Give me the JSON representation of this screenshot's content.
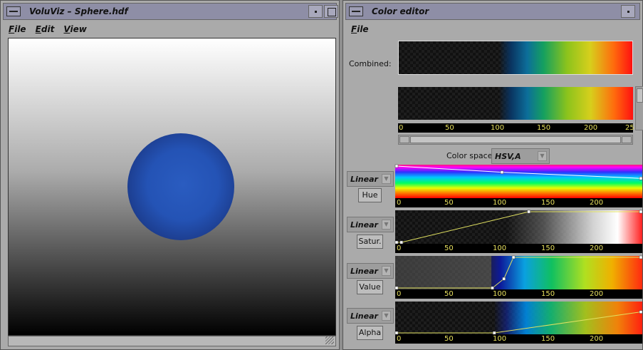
{
  "left_window": {
    "title": "VoluViz – Sphere.hdf",
    "menu": [
      "File",
      "Edit",
      "View"
    ]
  },
  "right_window": {
    "title": "Color editor",
    "menu": [
      "File"
    ],
    "combined_label": "Combined:",
    "color_space_label": "Color space:",
    "color_space_value": "HSV,A",
    "axis_ticks": [
      "0",
      "50",
      "100",
      "150",
      "200",
      "25"
    ],
    "channels": [
      {
        "name": "Hue",
        "interp": "Linear"
      },
      {
        "name": "Satur.",
        "interp": "Linear"
      },
      {
        "name": "Value",
        "interp": "Linear"
      },
      {
        "name": "Alpha",
        "interp": "Linear"
      }
    ]
  },
  "colors": {
    "window_bg": "#aaaaaa",
    "titlebar": "#8e8ea6",
    "axis_label": "#e7e05e",
    "curve": "#e0e060",
    "sphere": "#2453b5"
  },
  "chart_data": [
    {
      "type": "line",
      "title": "Hue",
      "x": [
        0,
        110,
        255
      ],
      "y": [
        1.0,
        0.8,
        0.6
      ],
      "xlim": [
        0,
        255
      ],
      "ylim": [
        0,
        1
      ]
    },
    {
      "type": "line",
      "title": "Satur.",
      "x": [
        0,
        5,
        138,
        255
      ],
      "y": [
        0.0,
        0.0,
        1.0,
        1.0
      ],
      "xlim": [
        0,
        255
      ],
      "ylim": [
        0,
        1
      ]
    },
    {
      "type": "line",
      "title": "Value",
      "x": [
        0,
        100,
        112,
        122,
        255
      ],
      "y": [
        0.0,
        0.0,
        0.3,
        1.0,
        1.0
      ],
      "xlim": [
        0,
        255
      ],
      "ylim": [
        0,
        1
      ]
    },
    {
      "type": "line",
      "title": "Alpha",
      "x": [
        0,
        102,
        255
      ],
      "y": [
        0.0,
        0.0,
        0.7
      ],
      "xlim": [
        0,
        255
      ],
      "ylim": [
        0,
        1
      ]
    }
  ]
}
